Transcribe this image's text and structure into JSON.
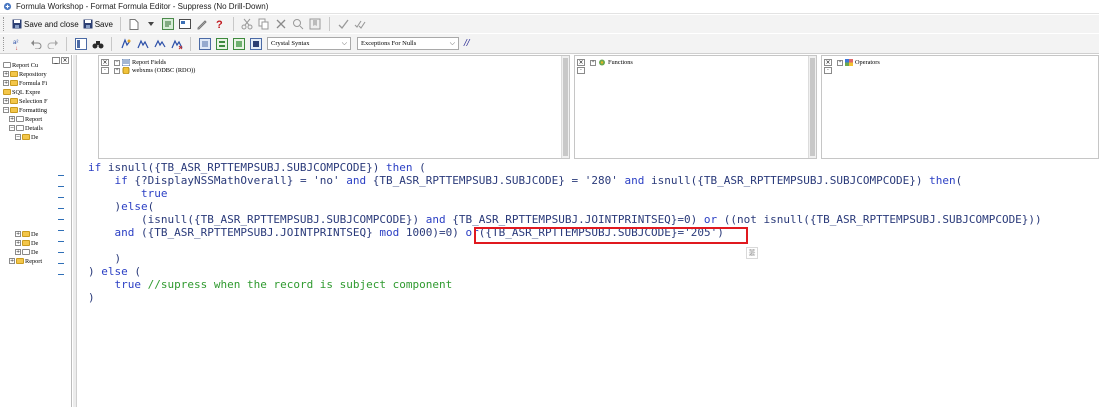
{
  "window": {
    "title": "Formula Workshop - Format Formula Editor - Suppress (No Drill-Down)"
  },
  "toolbar": {
    "save_close_label": "Save and close",
    "save_label": "Save",
    "syntax_select": "Crystal Syntax",
    "nulls_select": "Exceptions For Nulls",
    "comment_label": "//"
  },
  "tree": {
    "items": [
      {
        "label": "Report Cu",
        "prefix": ""
      },
      {
        "label": "Repository",
        "prefix": "+"
      },
      {
        "label": "Formula Fi",
        "prefix": "+"
      },
      {
        "label": "SQL Expre",
        "prefix": ""
      },
      {
        "label": "Selection F",
        "prefix": "+"
      },
      {
        "label": "Formatting",
        "prefix": "−"
      },
      {
        "label": "Report",
        "prefix": "+"
      },
      {
        "label": "Details",
        "prefix": "−"
      },
      {
        "label": "De",
        "prefix": "−"
      },
      {
        "label": "De",
        "prefix": "+"
      },
      {
        "label": "De",
        "prefix": "+"
      },
      {
        "label": "De",
        "prefix": "+"
      },
      {
        "label": "Report",
        "prefix": "+"
      }
    ]
  },
  "fields_panel": {
    "root_label": "Report Fields",
    "child_label": "webxms (ODBC (RDO))"
  },
  "functions_panel": {
    "root_label": "Functions"
  },
  "operators_panel": {
    "root_label": "Operators"
  },
  "editor": {
    "lines": [
      {
        "indent": "",
        "parts": [
          {
            "c": "kw",
            "t": "if "
          },
          {
            "c": "txt",
            "t": "isnull({TB_ASR_RPTTEMPSUBJ.SUBJCOMPCODE}) "
          },
          {
            "c": "kw",
            "t": "then"
          },
          {
            "c": "txt",
            "t": " ("
          }
        ]
      },
      {
        "indent": "    ",
        "parts": [
          {
            "c": "kw",
            "t": "if "
          },
          {
            "c": "txt",
            "t": "{?DisplayNSSMathOverall} = 'no' "
          },
          {
            "c": "kw",
            "t": "and"
          },
          {
            "c": "txt",
            "t": " {TB_ASR_RPTTEMPSUBJ.SUBJCODE} = '280' "
          },
          {
            "c": "kw",
            "t": "and"
          },
          {
            "c": "txt",
            "t": " isnull({TB_ASR_RPTTEMPSUBJ.SUBJCOMPCODE}) "
          },
          {
            "c": "kw",
            "t": "then"
          },
          {
            "c": "txt",
            "t": "("
          }
        ]
      },
      {
        "indent": "        ",
        "parts": [
          {
            "c": "kw",
            "t": "true"
          }
        ]
      },
      {
        "indent": "    ",
        "parts": [
          {
            "c": "txt",
            "t": ")"
          },
          {
            "c": "kw",
            "t": "else"
          },
          {
            "c": "txt",
            "t": "("
          }
        ]
      },
      {
        "indent": "        ",
        "parts": [
          {
            "c": "txt",
            "t": "(isnull({TB_ASR_RPTTEMPSUBJ.SUBJCOMPCODE}) "
          },
          {
            "c": "kw",
            "t": "and"
          },
          {
            "c": "txt",
            "t": " {TB_ASR_RPTTEMPSUBJ.JOINTPRINTSEQ}=0) "
          },
          {
            "c": "kw",
            "t": "or"
          },
          {
            "c": "txt",
            "t": " ((not isnull({TB_ASR_RPTTEMPSUBJ.SUBJCOMPCODE}))"
          }
        ]
      },
      {
        "indent": "    ",
        "parts": [
          {
            "c": "kw",
            "t": "and"
          },
          {
            "c": "txt",
            "t": " ({TB_ASR_RPTTEMPSUBJ.JOINTPRINTSEQ} "
          },
          {
            "c": "kw",
            "t": "mod"
          },
          {
            "c": "txt",
            "t": " 1000)=0) "
          },
          {
            "c": "kw",
            "t": "or"
          },
          {
            "c": "txt",
            "t": "({TB_ASR_RPTTEMPSUBJ.SUBJCODE}='205')"
          }
        ]
      },
      {
        "indent": "",
        "parts": []
      },
      {
        "indent": "    ",
        "parts": [
          {
            "c": "txt",
            "t": ")"
          }
        ]
      },
      {
        "indent": "",
        "parts": [
          {
            "c": "txt",
            "t": ") "
          },
          {
            "c": "kw",
            "t": "else"
          },
          {
            "c": "txt",
            "t": " ("
          }
        ]
      },
      {
        "indent": "    ",
        "parts": [
          {
            "c": "kw",
            "t": "true"
          },
          {
            "c": "cmt",
            "t": " //supress when the record is subject component"
          }
        ]
      },
      {
        "indent": "",
        "parts": [
          {
            "c": "txt",
            "t": ")"
          }
        ]
      }
    ]
  },
  "hint_glyph": "萋"
}
